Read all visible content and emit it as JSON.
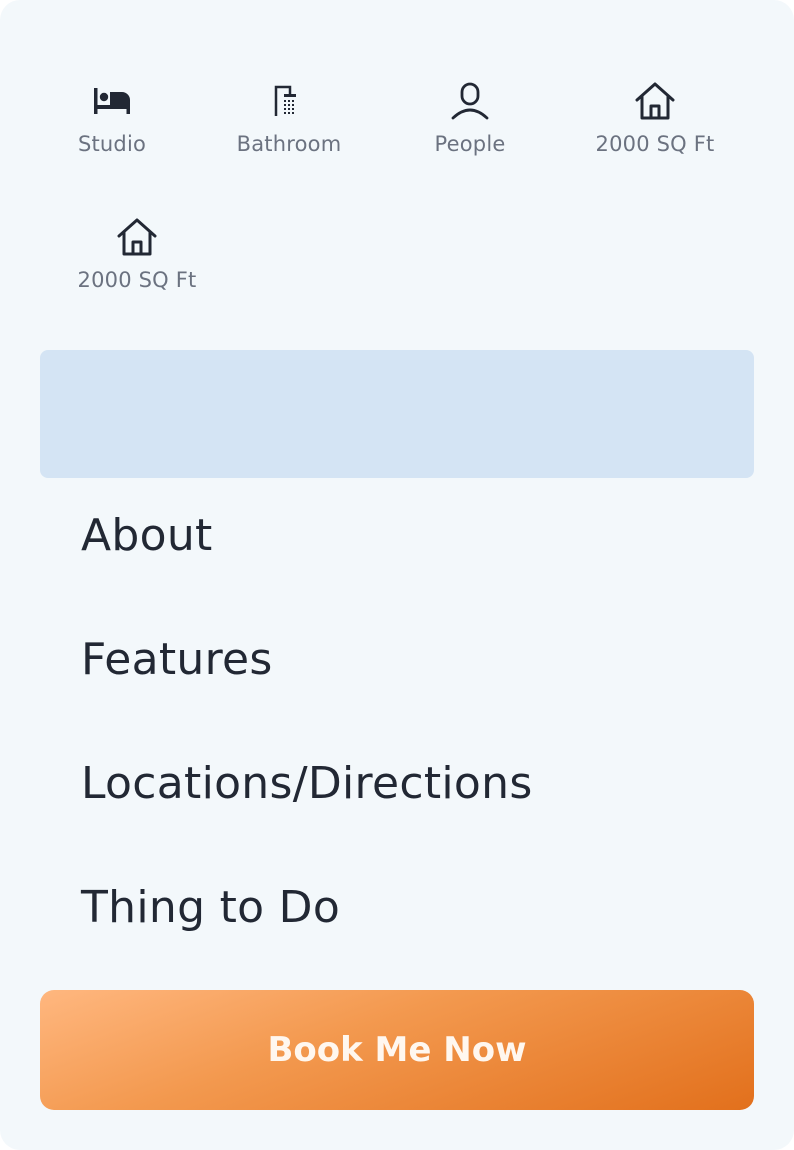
{
  "amenities": [
    {
      "label": "Studio",
      "icon": "bed-icon"
    },
    {
      "label": "Bathroom",
      "icon": "shower-icon"
    },
    {
      "label": "People",
      "icon": "person-icon"
    },
    {
      "label": "2000 SQ Ft",
      "icon": "house-icon"
    },
    {
      "label": "2000 SQ Ft",
      "icon": "house-icon"
    }
  ],
  "menu": {
    "items": [
      "About",
      "Features",
      "Locations/Directions",
      "Thing to Do"
    ]
  },
  "cta": {
    "label": "Book Me Now"
  },
  "colors": {
    "card_background": "#f3f8fb",
    "banner": "#d4e4f4",
    "text_dark": "#222834",
    "text_muted": "#6b7280",
    "button_gradient_start": "#ffb77f",
    "button_gradient_end": "#e2701c"
  }
}
